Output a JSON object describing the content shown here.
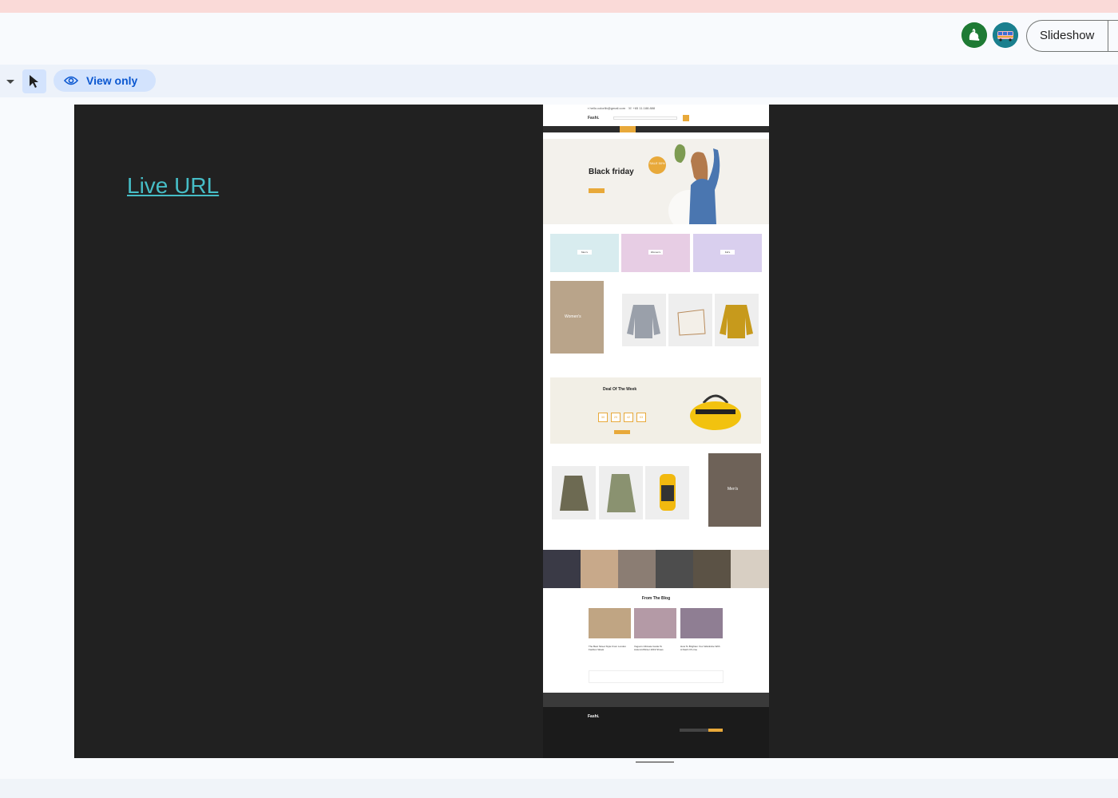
{
  "header": {
    "slideshow_label": "Slideshow",
    "avatars": [
      {
        "icon": "squirrel-avatar-icon",
        "color": "#1e7a34"
      },
      {
        "icon": "bus-avatar-icon",
        "color": "#1a7f8e"
      }
    ]
  },
  "toolbar": {
    "view_only_label": "View only",
    "select_tool_icon": "cursor-arrow-icon",
    "accent": "#0b57d0"
  },
  "slide": {
    "link_text": "Live URL",
    "link_color": "#46bdc6",
    "background": "#212121"
  },
  "thumbnail": {
    "logo": "Fashi.",
    "hero_title": "Black friday",
    "hero_badge": "SALE 50%",
    "categories": [
      "Men's",
      "Women's",
      "Kid's"
    ],
    "womens_banner": "Women's",
    "mens_banner": "Men's",
    "deal_title": "Deal Of The Week",
    "timer": [
      "30",
      "20",
      "42",
      "03"
    ],
    "blog_title": "From The Blog",
    "blog_posts": [
      "The Best Street Style From London Fashion Week",
      "Vogue's Ultimate Guide To Autumn/Winter 2019 Shoes",
      "How To Brighten Your Wardrobe With A Dash Of Lime"
    ],
    "accent": "#e8a93a"
  }
}
